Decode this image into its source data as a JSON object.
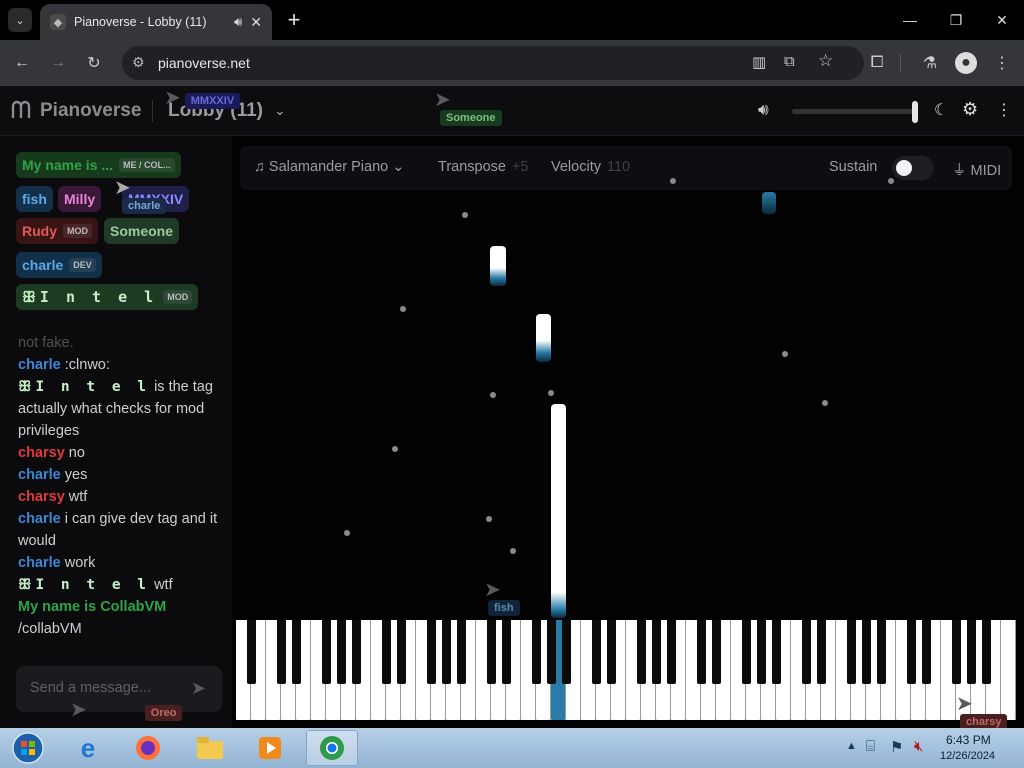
{
  "browser": {
    "tab_title": "Pianoverse - Lobby (11)",
    "url": "pianoverse.net",
    "icons": [
      "tab-search-icon",
      "audio-playing-icon",
      "close-tab-icon",
      "new-tab-icon",
      "minimize-icon",
      "restore-icon",
      "close-window-icon",
      "back-icon",
      "forward-icon",
      "reload-icon",
      "site-info-icon",
      "reading-mode-icon",
      "install-app-icon",
      "bookmark-star-icon",
      "extensions-icon",
      "labs-icon",
      "profile-icon",
      "menu-icon"
    ]
  },
  "app": {
    "logo": "Pianoverse",
    "room": "Lobby (11)",
    "volume_fraction": 1.0,
    "colors": {
      "accent": "#2a7ca8",
      "background": "#020203"
    }
  },
  "controls": {
    "instrument": "Salamander Piano",
    "transpose_label": "Transpose",
    "transpose_value": "+5",
    "velocity_label": "Velocity",
    "velocity_value": "110",
    "sustain_label": "Sustain",
    "sustain_on": false,
    "midi_label": "MIDI"
  },
  "users": [
    {
      "name": "My name is ...",
      "badge": "ME / COL...",
      "color": "#2fa34a"
    },
    {
      "name": "fish",
      "badge": "",
      "color": "#5aa9e6"
    },
    {
      "name": "Milly",
      "badge": "",
      "color": "#e884d8"
    },
    {
      "name": "MMXXIV",
      "badge": "",
      "color": "#8b8bff"
    },
    {
      "name": "Rudy",
      "badge": "MOD",
      "color": "#e05a5a"
    },
    {
      "name": "Someone",
      "badge": "",
      "color": "#9acb9a"
    },
    {
      "name": "charle",
      "badge": "DEV",
      "color": "#5aa9e6"
    },
    {
      "name": "ꕥI n t e l",
      "badge": "MOD",
      "color": "#c8f0c8"
    }
  ],
  "chat": [
    {
      "name": "",
      "text": "not fake.",
      "name_color": "#cfcfcf"
    },
    {
      "name": "charle",
      "text": ":clnwo:",
      "name_color": "#3d86d6"
    },
    {
      "name": "ꕥI n t e l",
      "text": "is the tag actually what checks for mod privileges",
      "name_color": "#c8f0c8"
    },
    {
      "name": "charsy",
      "text": "no",
      "name_color": "#e03a3a"
    },
    {
      "name": "charle",
      "text": "yes",
      "name_color": "#3d86d6"
    },
    {
      "name": "charsy",
      "text": "wtf",
      "name_color": "#e03a3a"
    },
    {
      "name": "charle",
      "text": "i can give dev tag and it would",
      "name_color": "#3d86d6"
    },
    {
      "name": "charle",
      "text": "work",
      "name_color": "#3d86d6"
    },
    {
      "name": "ꕥI n t e l",
      "text": "wtf",
      "name_color": "#c8f0c8"
    },
    {
      "name": "My name is CollabVM",
      "text": "/collabVM",
      "name_color": "#2fa34a"
    }
  ],
  "chat_input": {
    "placeholder": "Send a message..."
  },
  "cursors": [
    {
      "label": "MMXXIV"
    },
    {
      "label": "Someone"
    },
    {
      "label": "charle"
    },
    {
      "label": "fish"
    },
    {
      "label": "Oreo"
    },
    {
      "label": "charsy"
    }
  ],
  "taskbar": {
    "time": "6:43 PM",
    "date": "12/26/2024",
    "apps": [
      "start-orb-icon",
      "internet-explorer-icon",
      "firefox-icon",
      "file-explorer-icon",
      "media-player-icon",
      "chrome-icon"
    ]
  }
}
